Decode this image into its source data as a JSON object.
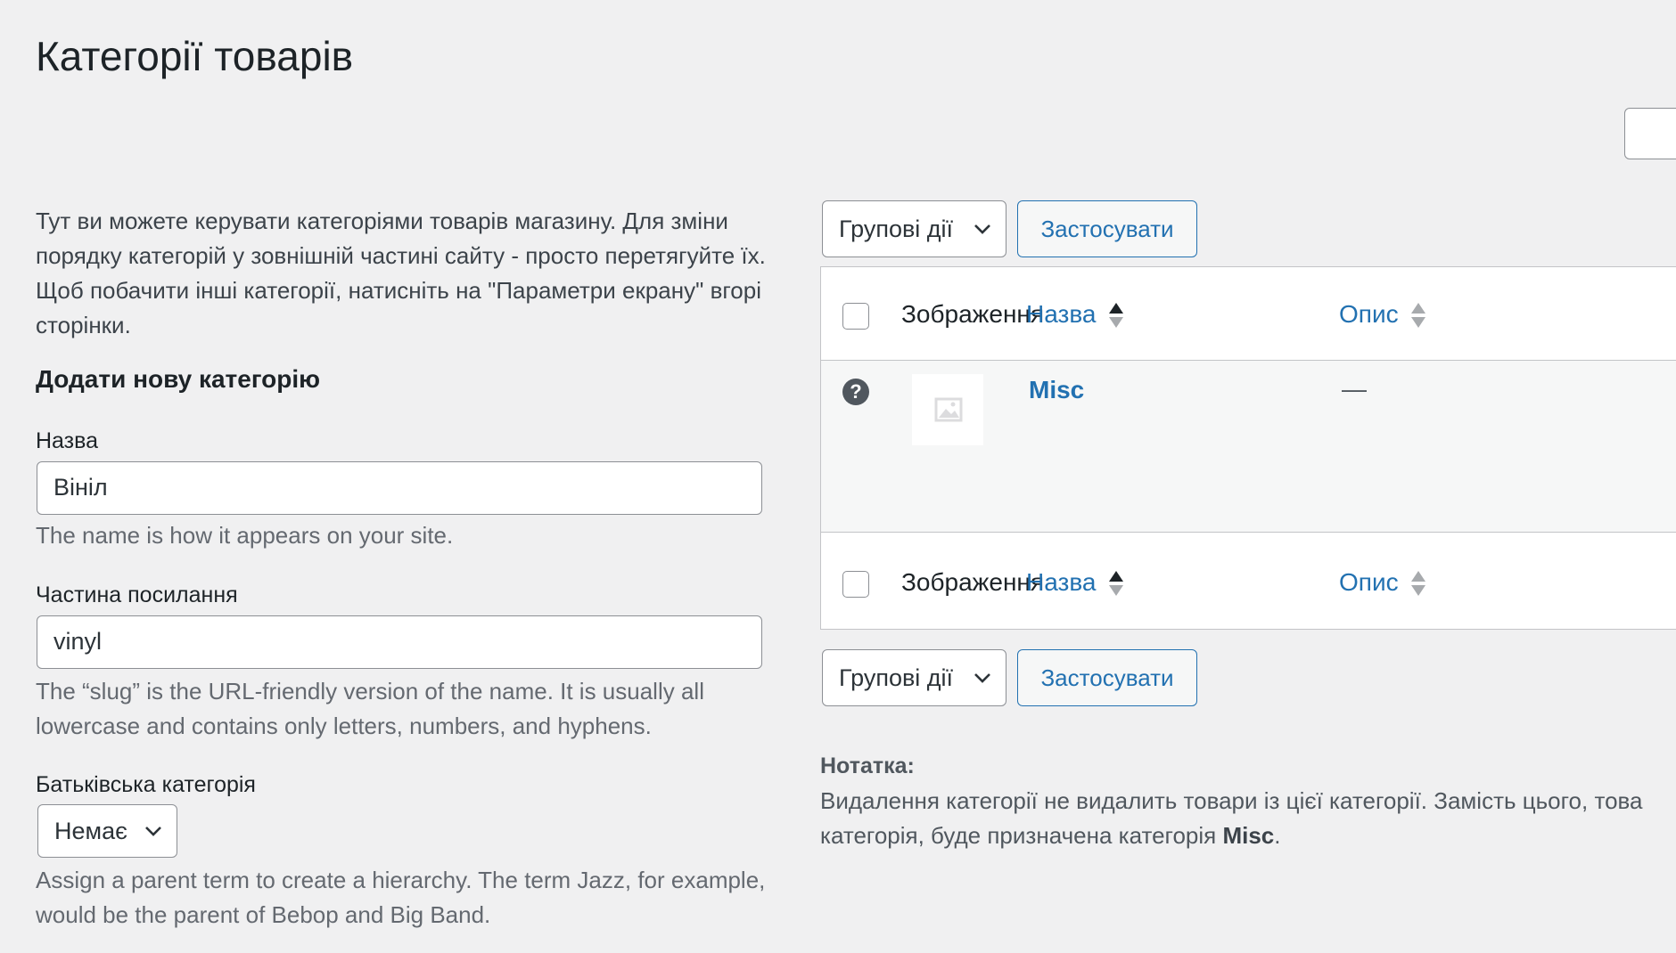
{
  "page": {
    "title": "Категорії товарів"
  },
  "intro": {
    "text": "Тут ви можете керувати категоріями товарів магазину. Для зміни порядку категорій у зовнішній частині сайту - просто перетягуйте їх. Щоб побачити інші категорії, натисніть на \"Параметри екрану\" вгорі сторінки."
  },
  "add_form": {
    "heading": "Додати нову категорію",
    "name_label": "Назва",
    "name_value": "Вініл",
    "name_help": "The name is how it appears on your site.",
    "slug_label": "Частина посилання",
    "slug_value": "vinyl",
    "slug_help": "The “slug” is the URL-friendly version of the name. It is usually all lowercase and contains only letters, numbers, and hyphens.",
    "parent_label": "Батьківська категорія",
    "parent_value": "Немає",
    "parent_help": "Assign a parent term to create a hierarchy. The term Jazz, for example, would be the parent of Bebop and Big Band."
  },
  "bulk": {
    "actions_label": "Групові дії",
    "apply_label": "Застосувати"
  },
  "table": {
    "columns": {
      "image": "Зображення",
      "name": "Назва",
      "description": "Опис"
    },
    "rows": [
      {
        "name": "Misc",
        "description": "—"
      }
    ]
  },
  "note": {
    "title": "Нотатка:",
    "text_before": "Видалення категорії не видалить товари із цієї категорії. Замість цього, това",
    "text_line2": "категорія, буде призначена категорія ",
    "default_category": "Misc",
    "text_end": "."
  },
  "icons": {
    "help": "question-circle-icon",
    "thumbnail": "image-placeholder-icon",
    "sort": "sort-arrows-icon",
    "dropdown": "chevron-down-icon"
  }
}
